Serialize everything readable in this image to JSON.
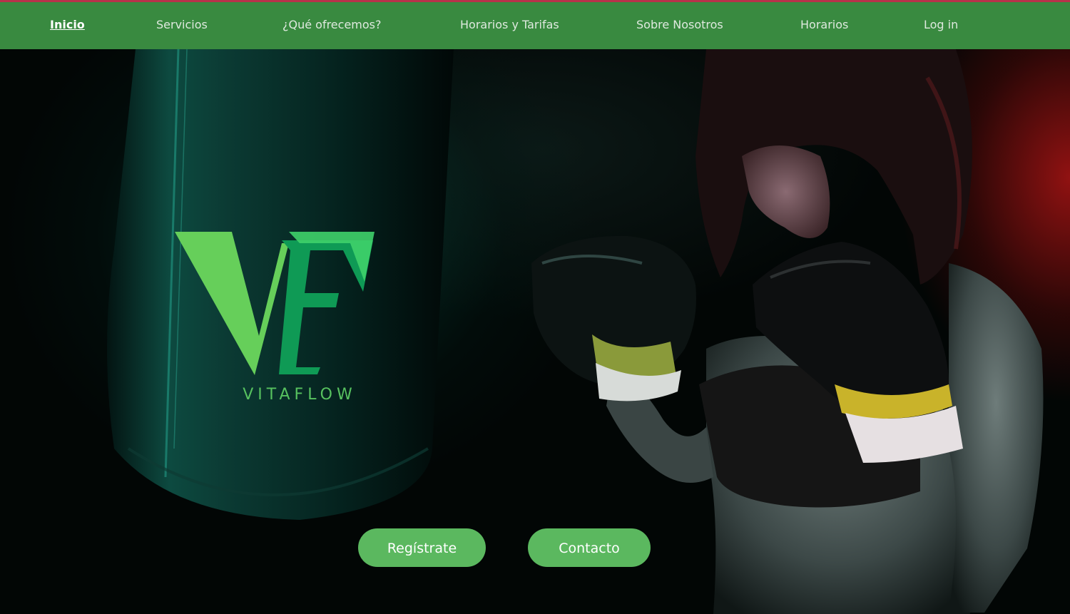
{
  "nav": {
    "items": [
      {
        "label": "Inicio",
        "active": true
      },
      {
        "label": "Servicios"
      },
      {
        "label": "¿Qué ofrecemos?"
      },
      {
        "label": "Horarios y Tarifas"
      },
      {
        "label": "Sobre Nosotros"
      },
      {
        "label": "Horarios"
      },
      {
        "label": "Log in"
      }
    ]
  },
  "hero": {
    "logo_letters": "VF",
    "brand_name": "VITAFLOW",
    "buttons": {
      "register_label": "Regístrate",
      "contact_label": "Contacto"
    }
  },
  "colors": {
    "nav_bg": "#398a40",
    "accent_line": "#b8324a",
    "button_bg": "#5bb85f",
    "logo_green": "#57c25f"
  }
}
